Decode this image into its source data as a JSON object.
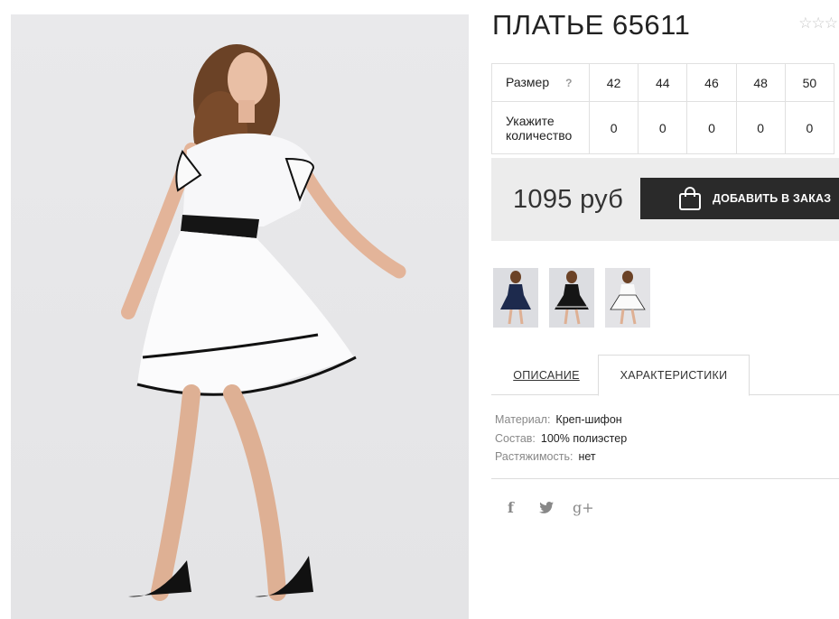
{
  "product": {
    "title": "ПЛАТЬЕ 65611",
    "rating_stars": [
      "☆",
      "☆",
      "☆"
    ]
  },
  "size_table": {
    "size_label": "Размер",
    "help": "?",
    "sizes": [
      "42",
      "44",
      "46",
      "48",
      "50"
    ],
    "qty_label": "Укажите количество",
    "quantities": [
      "0",
      "0",
      "0",
      "0",
      "0"
    ]
  },
  "purchase": {
    "price": "1095 руб",
    "add_button": "ДОБАВИТЬ В ЗАКАЗ"
  },
  "tabs": {
    "description": "ОПИСАНИЕ",
    "characteristics": "ХАРАКТЕРИСТИКИ"
  },
  "specs": [
    {
      "key": "Материал:",
      "value": "Креп-шифон"
    },
    {
      "key": "Состав:",
      "value": "100% полиэстер"
    },
    {
      "key": "Растяжимость:",
      "value": "нет"
    }
  ],
  "social": {
    "facebook": "f",
    "twitter": "t",
    "googleplus": "g+"
  },
  "icons": [
    "star-icon",
    "shopping-bag-icon",
    "facebook-icon",
    "twitter-icon",
    "google-plus-icon"
  ],
  "colors": {
    "button_bg": "#2a2a2a",
    "price_box_bg": "#ececec"
  }
}
